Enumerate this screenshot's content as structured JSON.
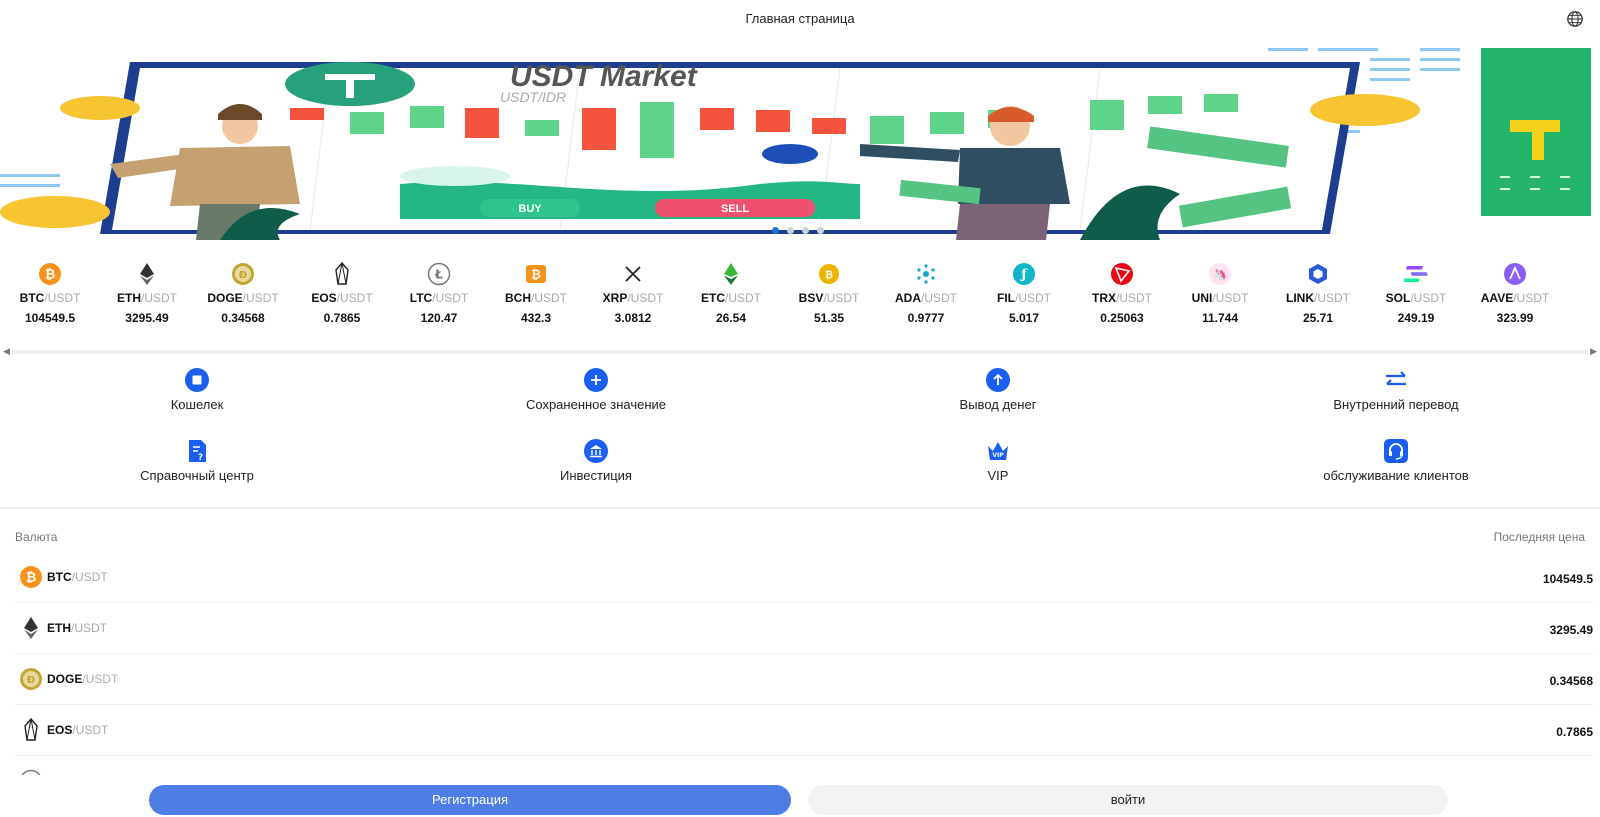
{
  "header": {
    "title": "Главная страница",
    "language_icon": "globe-icon"
  },
  "banner": {
    "heading": "USDT Market",
    "subheading": "USDT/IDR",
    "buy_label": "BUY",
    "sell_label": "SELL",
    "slide_count": 4,
    "active_slide": 1
  },
  "ticker": [
    {
      "base": "BTC",
      "quote": "/USDT",
      "price": "104549.5",
      "icon": "btc-icon",
      "color": "#f7931a"
    },
    {
      "base": "ETH",
      "quote": "/USDT",
      "price": "3295.49",
      "icon": "eth-icon",
      "color": "#444444"
    },
    {
      "base": "DOGE",
      "quote": "/USDT",
      "price": "0.34568",
      "icon": "doge-icon",
      "color": "#c2a633"
    },
    {
      "base": "EOS",
      "quote": "/USDT",
      "price": "0.7865",
      "icon": "eos-icon",
      "color": "#222222"
    },
    {
      "base": "LTC",
      "quote": "/USDT",
      "price": "120.47",
      "icon": "ltc-icon",
      "color": "#666666"
    },
    {
      "base": "BCH",
      "quote": "/USDT",
      "price": "432.3",
      "icon": "bch-icon",
      "color": "#f7931a"
    },
    {
      "base": "XRP",
      "quote": "/USDT",
      "price": "3.0812",
      "icon": "xrp-icon",
      "color": "#222222"
    },
    {
      "base": "ETC",
      "quote": "/USDT",
      "price": "26.54",
      "icon": "etc-icon",
      "color": "#3ab83a"
    },
    {
      "base": "BSV",
      "quote": "/USDT",
      "price": "51.35",
      "icon": "bsv-icon",
      "color": "#eab300"
    },
    {
      "base": "ADA",
      "quote": "/USDT",
      "price": "0.9777",
      "icon": "ada-icon",
      "color": "#17a2c9"
    },
    {
      "base": "FIL",
      "quote": "/USDT",
      "price": "5.017",
      "icon": "fil-icon",
      "color": "#0fb5c9"
    },
    {
      "base": "TRX",
      "quote": "/USDT",
      "price": "0.25063",
      "icon": "trx-icon",
      "color": "#e50914"
    },
    {
      "base": "UNI",
      "quote": "/USDT",
      "price": "11.744",
      "icon": "uni-icon",
      "color": "#ff007a"
    },
    {
      "base": "LINK",
      "quote": "/USDT",
      "price": "25.71",
      "icon": "link-icon",
      "color": "#2a5ada"
    },
    {
      "base": "SOL",
      "quote": "/USDT",
      "price": "249.19",
      "icon": "sol-icon",
      "color": "#9945ff"
    },
    {
      "base": "AAVE",
      "quote": "/USDT",
      "price": "323.99",
      "icon": "aave-icon",
      "color": "#8b5cf6"
    }
  ],
  "menu": [
    {
      "label": "Кошелек",
      "icon": "wallet-icon"
    },
    {
      "label": "Сохраненное значение",
      "icon": "deposit-plus-icon"
    },
    {
      "label": "Вывод денег",
      "icon": "withdraw-arrow-icon"
    },
    {
      "label": "Внутренний перевод",
      "icon": "transfer-arrows-icon"
    },
    {
      "label": "Справочный центр",
      "icon": "help-document-icon"
    },
    {
      "label": "Инвестиция",
      "icon": "investment-bank-icon"
    },
    {
      "label": "VIP",
      "icon": "vip-crown-icon"
    },
    {
      "label": "обслуживание клиентов",
      "icon": "customer-service-headset-icon"
    }
  ],
  "market": {
    "col_currency": "Валюта",
    "col_price": "Последняя цена",
    "rows": [
      {
        "base": "BTC",
        "quote": "/USDT",
        "price": "104549.5"
      },
      {
        "base": "ETH",
        "quote": "/USDT",
        "price": "3295.49"
      },
      {
        "base": "DOGE",
        "quote": "/USDT",
        "price": "0.34568"
      },
      {
        "base": "EOS",
        "quote": "/USDT",
        "price": "0.7865"
      }
    ]
  },
  "actions": {
    "register": "Регистрация",
    "login": "войти"
  },
  "colors": {
    "accent": "#1a5ff2",
    "register_button": "#4e7ee5"
  }
}
